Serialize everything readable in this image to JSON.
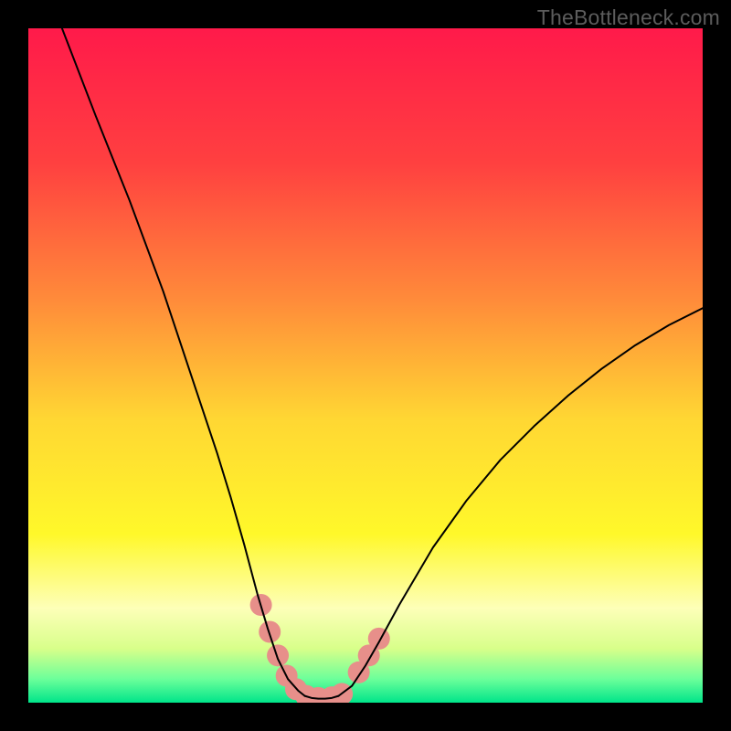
{
  "watermark": "TheBottleneck.com",
  "chart_data": {
    "type": "line",
    "title": "",
    "xlabel": "",
    "ylabel": "",
    "xlim": [
      0,
      100
    ],
    "ylim": [
      0,
      100
    ],
    "background_gradient": {
      "direction": "vertical",
      "stops": [
        {
          "pos": 0.0,
          "color": "#ff1a4a"
        },
        {
          "pos": 0.2,
          "color": "#ff4040"
        },
        {
          "pos": 0.4,
          "color": "#ff8a3a"
        },
        {
          "pos": 0.58,
          "color": "#ffd733"
        },
        {
          "pos": 0.75,
          "color": "#fff82a"
        },
        {
          "pos": 0.86,
          "color": "#fdffb8"
        },
        {
          "pos": 0.92,
          "color": "#d8ff8a"
        },
        {
          "pos": 0.965,
          "color": "#6cff9a"
        },
        {
          "pos": 1.0,
          "color": "#00e58a"
        }
      ]
    },
    "series": [
      {
        "name": "left-branch",
        "stroke": "#000000",
        "x": [
          5,
          10,
          15,
          20,
          22,
          25,
          28,
          30,
          32,
          34,
          35.5,
          37,
          38.5,
          40,
          41
        ],
        "y": [
          100,
          87,
          74.5,
          61,
          55,
          46,
          37,
          30.5,
          23.5,
          16,
          11,
          6.5,
          3.5,
          1.8,
          1.0
        ]
      },
      {
        "name": "right-branch",
        "stroke": "#000000",
        "x": [
          46,
          48,
          50,
          52,
          55,
          60,
          65,
          70,
          75,
          80,
          85,
          90,
          95,
          100
        ],
        "y": [
          1.0,
          2.5,
          5.5,
          9,
          14.5,
          23,
          30,
          36,
          41,
          45.5,
          49.5,
          53,
          56,
          58.5
        ]
      },
      {
        "name": "valley-floor",
        "stroke": "#000000",
        "x": [
          41,
          42,
          43,
          44,
          45,
          46
        ],
        "y": [
          1.0,
          0.7,
          0.6,
          0.6,
          0.7,
          1.0
        ]
      }
    ],
    "markers": {
      "name": "highlight-beads",
      "color": "#e78f8a",
      "radius_px": 12,
      "points": [
        {
          "x": 34.5,
          "y": 14.5
        },
        {
          "x": 35.8,
          "y": 10.5
        },
        {
          "x": 37.0,
          "y": 7.0
        },
        {
          "x": 38.3,
          "y": 4.0
        },
        {
          "x": 39.7,
          "y": 2.0
        },
        {
          "x": 41.2,
          "y": 1.0
        },
        {
          "x": 43.0,
          "y": 0.7
        },
        {
          "x": 45.0,
          "y": 0.8
        },
        {
          "x": 46.5,
          "y": 1.3
        },
        {
          "x": 49.0,
          "y": 4.5
        },
        {
          "x": 50.5,
          "y": 7.0
        },
        {
          "x": 52.0,
          "y": 9.5
        }
      ]
    }
  }
}
